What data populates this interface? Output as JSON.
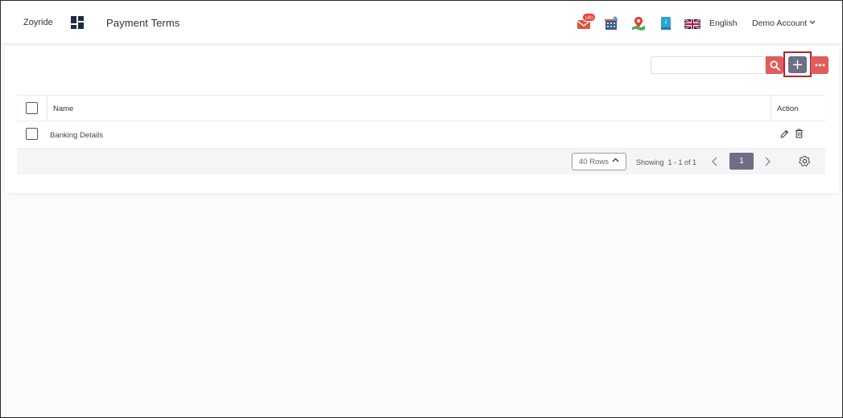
{
  "header": {
    "brand": "Zoyride",
    "page_title": "Payment Terms",
    "notification_count": "180",
    "language": "English",
    "account": "Demo Account"
  },
  "toolbar": {
    "search_value": "",
    "search_placeholder": "",
    "icons": {
      "search": "search-icon",
      "add": "plus-icon",
      "more": "more-horizontal-icon"
    }
  },
  "table": {
    "columns": [
      "Name",
      "Action"
    ],
    "rows": [
      {
        "name": "Banking Details"
      }
    ]
  },
  "footer": {
    "rows_per_page": "40 Rows",
    "showing": "Showing  1 - 1 of 1",
    "current_page": "1"
  },
  "colors": {
    "accent_red": "#e25c5c",
    "primary_slate": "#6e6f86",
    "highlight_border": "#b3262b",
    "badge_red": "#e53935"
  }
}
